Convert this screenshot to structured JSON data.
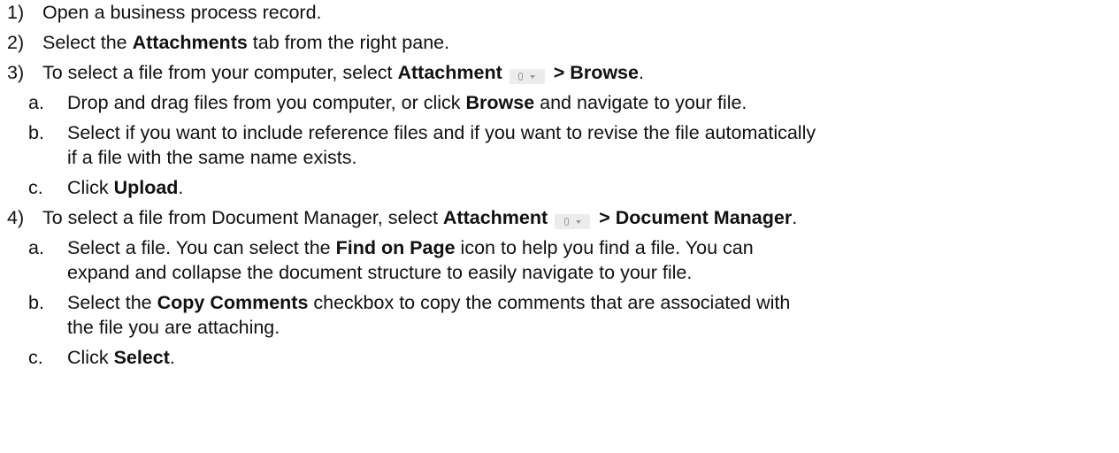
{
  "steps": [
    {
      "num": "1)",
      "text": "Open a business process record."
    },
    {
      "num": "2)",
      "pre": "Select the ",
      "bold": "Attachments",
      "post": " tab from the right pane."
    },
    {
      "num": "3)",
      "pre": "To select a file from your computer, select ",
      "bold1": "Attachment",
      "icon": "attachment-paperclip-dropdown-icon",
      "bold2": "> Browse",
      "post": ".",
      "sub": [
        {
          "letter": "a.",
          "pre": "Drop and drag files from you computer, or click ",
          "bold": "Browse",
          "post": " and navigate to your file."
        },
        {
          "letter": "b.",
          "line1": "Select if you want to include reference files and if you want to revise the file automatically",
          "line2": "if a file with the same name exists."
        },
        {
          "letter": "c.",
          "pre": "Click ",
          "bold": "Upload",
          "post": "."
        }
      ]
    },
    {
      "num": "4)",
      "pre": "To select a file from Document Manager, select ",
      "bold1": "Attachment",
      "icon": "attachment-paperclip-dropdown-icon",
      "bold2": "> Document Manager",
      "post": ".",
      "sub": [
        {
          "letter": "a.",
          "pre": "Select a file. You can select the ",
          "bold": "Find on Page",
          "post": " icon to help you find a file. You can",
          "line2": "expand and collapse the document structure to easily navigate to your file."
        },
        {
          "letter": "b.",
          "pre": "Select the ",
          "bold": "Copy Comments",
          "post": " checkbox to copy the comments that are associated with",
          "line2": "the file you are attaching."
        },
        {
          "letter": "c.",
          "pre": "Click ",
          "bold": "Select",
          "post": "."
        }
      ]
    }
  ]
}
